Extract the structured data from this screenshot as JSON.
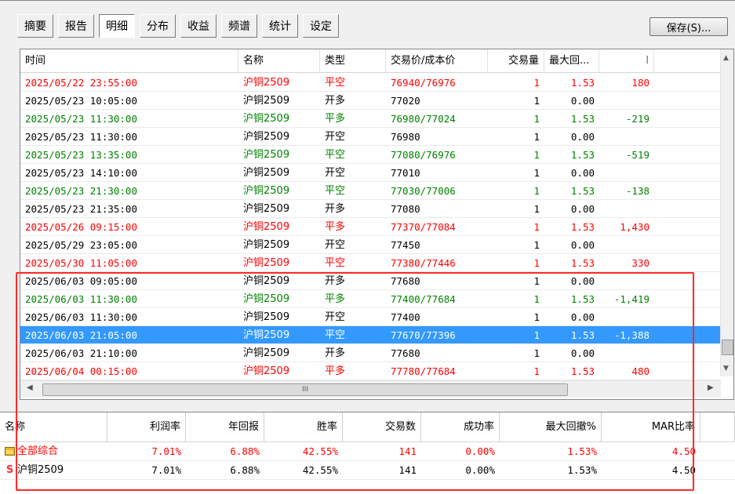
{
  "tabs": [
    "摘要",
    "报告",
    "明细",
    "分布",
    "收益",
    "频谱",
    "统计",
    "设定"
  ],
  "save_label": "保存(S)...",
  "detail_table": {
    "columns": [
      "时间",
      "名称",
      "类型",
      "交易价/成本价",
      "交易量",
      "最大回...",
      "l"
    ],
    "rows": [
      {
        "color": "red",
        "time": "2025/05/22 23:55:00",
        "name": "沪铜2509",
        "type": "平空",
        "price": "76940/76976",
        "vol": "1",
        "dd": "1.53",
        "pnl": "180"
      },
      {
        "color": "black",
        "time": "2025/05/23 10:05:00",
        "name": "沪铜2509",
        "type": "开多",
        "price": "77020",
        "vol": "1",
        "dd": "0.00",
        "pnl": ""
      },
      {
        "color": "green",
        "time": "2025/05/23 11:30:00",
        "name": "沪铜2509",
        "type": "平多",
        "price": "76980/77024",
        "vol": "1",
        "dd": "1.53",
        "pnl": "-219"
      },
      {
        "color": "black",
        "time": "2025/05/23 11:30:00",
        "name": "沪铜2509",
        "type": "开空",
        "price": "76980",
        "vol": "1",
        "dd": "0.00",
        "pnl": ""
      },
      {
        "color": "green",
        "time": "2025/05/23 13:35:00",
        "name": "沪铜2509",
        "type": "平空",
        "price": "77080/76976",
        "vol": "1",
        "dd": "1.53",
        "pnl": "-519"
      },
      {
        "color": "black",
        "time": "2025/05/23 14:10:00",
        "name": "沪铜2509",
        "type": "开空",
        "price": "77010",
        "vol": "1",
        "dd": "0.00",
        "pnl": ""
      },
      {
        "color": "green",
        "time": "2025/05/23 21:30:00",
        "name": "沪铜2509",
        "type": "平空",
        "price": "77030/77006",
        "vol": "1",
        "dd": "1.53",
        "pnl": "-138"
      },
      {
        "color": "black",
        "time": "2025/05/23 21:35:00",
        "name": "沪铜2509",
        "type": "开多",
        "price": "77080",
        "vol": "1",
        "dd": "0.00",
        "pnl": ""
      },
      {
        "color": "red",
        "time": "2025/05/26 09:15:00",
        "name": "沪铜2509",
        "type": "平多",
        "price": "77370/77084",
        "vol": "1",
        "dd": "1.53",
        "pnl": "1,430"
      },
      {
        "color": "black",
        "time": "2025/05/29 23:05:00",
        "name": "沪铜2509",
        "type": "开空",
        "price": "77450",
        "vol": "1",
        "dd": "0.00",
        "pnl": ""
      },
      {
        "color": "red",
        "time": "2025/05/30 11:05:00",
        "name": "沪铜2509",
        "type": "平空",
        "price": "77380/77446",
        "vol": "1",
        "dd": "1.53",
        "pnl": "330"
      },
      {
        "color": "black",
        "time": "2025/06/03 09:05:00",
        "name": "沪铜2509",
        "type": "开多",
        "price": "77680",
        "vol": "1",
        "dd": "0.00",
        "pnl": ""
      },
      {
        "color": "green",
        "time": "2025/06/03 11:30:00",
        "name": "沪铜2509",
        "type": "平多",
        "price": "77400/77684",
        "vol": "1",
        "dd": "1.53",
        "pnl": "-1,419"
      },
      {
        "color": "black",
        "time": "2025/06/03 11:30:00",
        "name": "沪铜2509",
        "type": "开空",
        "price": "77400",
        "vol": "1",
        "dd": "0.00",
        "pnl": ""
      },
      {
        "color": "sel",
        "time": "2025/06/03 21:05:00",
        "name": "沪铜2509",
        "type": "平空",
        "price": "77670/77396",
        "vol": "1",
        "dd": "1.53",
        "pnl": "-1,388"
      },
      {
        "color": "black",
        "time": "2025/06/03 21:10:00",
        "name": "沪铜2509",
        "type": "开多",
        "price": "77680",
        "vol": "1",
        "dd": "0.00",
        "pnl": ""
      },
      {
        "color": "red",
        "time": "2025/06/04 00:15:00",
        "name": "沪铜2509",
        "type": "平多",
        "price": "77780/77684",
        "vol": "1",
        "dd": "1.53",
        "pnl": "480"
      }
    ],
    "hscroll_grip": "III"
  },
  "summary_table": {
    "columns": [
      "名称",
      "利润率",
      "年回报",
      "胜率",
      "交易数",
      "成功率",
      "最大回撤%",
      "MAR比率"
    ],
    "rows": [
      {
        "icon": "folder-icon",
        "color": "red",
        "name": "全部综合",
        "profit": "7.01%",
        "annual": "6.88%",
        "win": "42.55%",
        "trades": "141",
        "success": "0.00%",
        "maxdd": "1.53%",
        "mar": "4.50"
      },
      {
        "icon": "dollar-icon",
        "color": "black",
        "name": "沪铜2509",
        "profit": "7.01%",
        "annual": "6.88%",
        "win": "42.55%",
        "trades": "141",
        "success": "0.00%",
        "maxdd": "1.53%",
        "mar": "4.50"
      }
    ]
  },
  "colors": {
    "red": "#ff0000",
    "green": "#008000",
    "selection": "#3399ff",
    "annotation": "#ff2a2a"
  }
}
